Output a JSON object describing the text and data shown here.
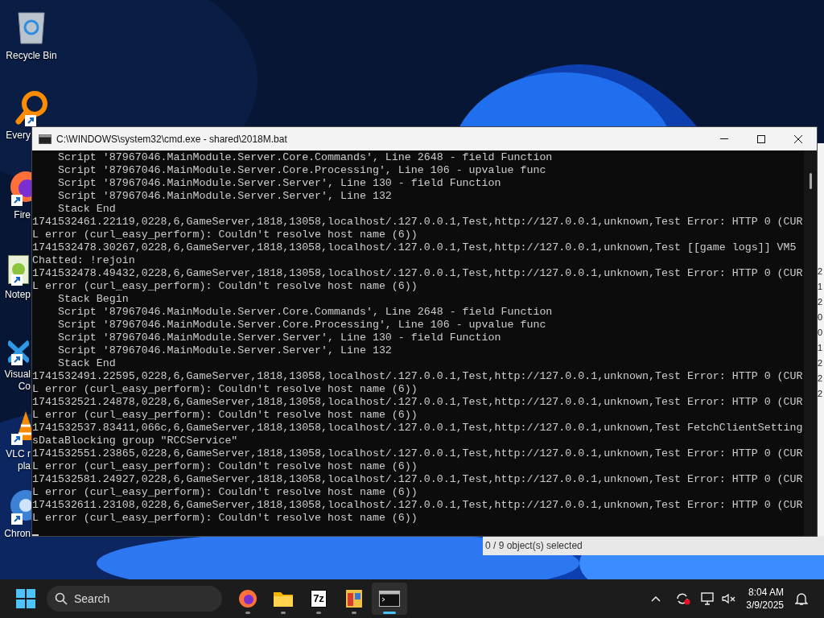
{
  "desktop_icons": [
    {
      "kind": "recycle-bin",
      "shortcut": false,
      "lines": [
        "Recycle Bin"
      ]
    },
    {
      "kind": "magnifier",
      "shortcut": true,
      "lines": [
        "Every"
      ]
    },
    {
      "kind": "firefox",
      "shortcut": true,
      "lines": [
        "Fire"
      ]
    },
    {
      "kind": "notepad",
      "shortcut": true,
      "lines": [
        "Notep"
      ]
    },
    {
      "kind": "vscode",
      "shortcut": true,
      "lines": [
        "Visual",
        "Co"
      ]
    },
    {
      "kind": "vlc",
      "shortcut": true,
      "lines": [
        "VLC r",
        "pla"
      ]
    },
    {
      "kind": "chrome",
      "shortcut": true,
      "lines": [
        "Chron"
      ]
    }
  ],
  "explorer": {
    "column_digits": [
      "2",
      "1",
      "2",
      "0",
      "0",
      "1",
      "2",
      "2",
      "2"
    ],
    "status": "0 / 9 object(s) selected"
  },
  "console": {
    "title": "C:\\WINDOWS\\system32\\cmd.exe - shared\\2018M.bat",
    "lines": [
      "    Script '87967046.MainModule.Server.Core.Commands', Line 2648 - field Function",
      "    Script '87967046.MainModule.Server.Core.Processing', Line 106 - upvalue func",
      "    Script '87967046.MainModule.Server.Server', Line 130 - field Function",
      "    Script '87967046.MainModule.Server.Server', Line 132",
      "    Stack End",
      "1741532461.22119,0228,6,GameServer,1818,13058,localhost/.127.0.0.1,Test,http://127.0.0.1,unknown,Test Error: HTTP 0 (CUR",
      "L error (curl_easy_perform): Couldn't resolve host name (6))",
      "1741532478.30267,0228,6,GameServer,1818,13058,localhost/.127.0.0.1,Test,http://127.0.0.1,unknown,Test [[game logs]] VM5",
      "Chatted: !rejoin",
      "1741532478.49432,0228,6,GameServer,1818,13058,localhost/.127.0.0.1,Test,http://127.0.0.1,unknown,Test Error: HTTP 0 (CUR",
      "L error (curl_easy_perform): Couldn't resolve host name (6))",
      "    Stack Begin",
      "    Script '87967046.MainModule.Server.Core.Commands', Line 2648 - field Function",
      "    Script '87967046.MainModule.Server.Core.Processing', Line 106 - upvalue func",
      "    Script '87967046.MainModule.Server.Server', Line 130 - field Function",
      "    Script '87967046.MainModule.Server.Server', Line 132",
      "    Stack End",
      "1741532491.22595,0228,6,GameServer,1818,13058,localhost/.127.0.0.1,Test,http://127.0.0.1,unknown,Test Error: HTTP 0 (CUR",
      "L error (curl_easy_perform): Couldn't resolve host name (6))",
      "1741532521.24878,0228,6,GameServer,1818,13058,localhost/.127.0.0.1,Test,http://127.0.0.1,unknown,Test Error: HTTP 0 (CUR",
      "L error (curl_easy_perform): Couldn't resolve host name (6))",
      "1741532537.83411,066c,6,GameServer,1818,13058,localhost/.127.0.0.1,Test,http://127.0.0.1,unknown,Test FetchClientSetting",
      "sDataBlocking group \"RCCService\"",
      "1741532551.23865,0228,6,GameServer,1818,13058,localhost/.127.0.0.1,Test,http://127.0.0.1,unknown,Test Error: HTTP 0 (CUR",
      "L error (curl_easy_perform): Couldn't resolve host name (6))",
      "1741532581.24927,0228,6,GameServer,1818,13058,localhost/.127.0.0.1,Test,http://127.0.0.1,unknown,Test Error: HTTP 0 (CUR",
      "L error (curl_easy_perform): Couldn't resolve host name (6))",
      "1741532611.23108,0228,6,GameServer,1818,13058,localhost/.127.0.0.1,Test,http://127.0.0.1,unknown,Test Error: HTTP 0 (CUR",
      "L error (curl_easy_perform): Couldn't resolve host name (6))"
    ]
  },
  "taskbar": {
    "search_placeholder": "Search",
    "apps": [
      {
        "kind": "firefox",
        "selected": false
      },
      {
        "kind": "folder",
        "selected": false
      },
      {
        "kind": "archiver",
        "label": "7z",
        "selected": false
      },
      {
        "kind": "paint",
        "selected": false
      },
      {
        "kind": "terminal",
        "selected": true
      }
    ],
    "time": "8:04 AM",
    "date": "3/9/2025"
  }
}
